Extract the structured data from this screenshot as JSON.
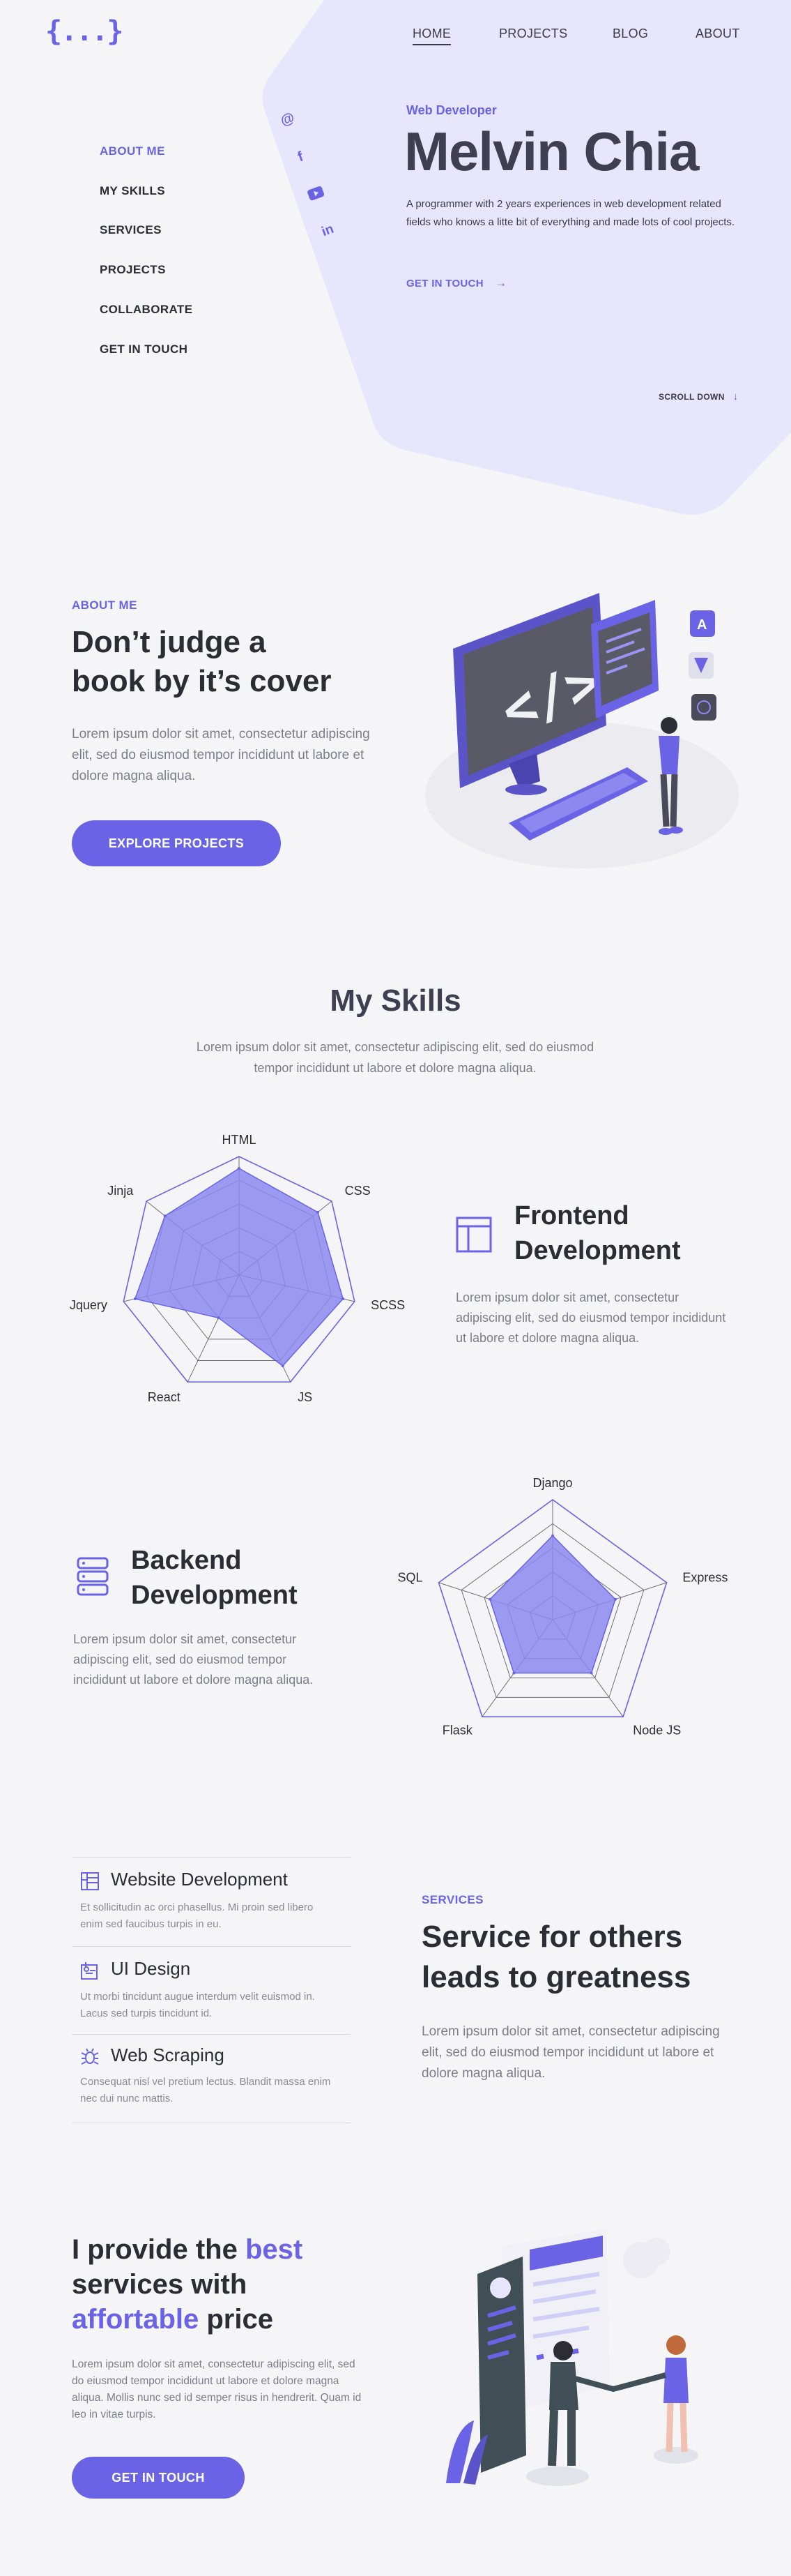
{
  "logo": "{...}",
  "nav": [
    "HOME",
    "PROJECTS",
    "BLOG",
    "ABOUT"
  ],
  "side_menu": [
    "ABOUT ME",
    "MY SKILLS",
    "SERVICES",
    "PROJECTS",
    "COLLABORATE",
    "GET IN TOUCH"
  ],
  "social_icons": [
    "at-icon",
    "facebook-icon",
    "youtube-icon",
    "linkedin-icon"
  ],
  "hero": {
    "role": "Web Developer",
    "name": "Melvin Chia",
    "bio": "A programmer with 2 years experiences in web development related fields who knows a litte bit of everything and made lots of cool projects.",
    "cta": "GET IN TOUCH",
    "scroll": "SCROLL DOWN"
  },
  "about": {
    "eyebrow": "ABOUT ME",
    "heading_line1": "Don’t judge a",
    "heading_line2": "book by it’s cover",
    "text": "Lorem ipsum dolor sit amet, consectetur adipiscing elit, sed do eiusmod tempor incididunt ut labore et dolore magna aliqua.",
    "button": "EXPLORE PROJECTS"
  },
  "skills": {
    "title": "My Skills",
    "text": "Lorem ipsum dolor sit amet, consectetur adipiscing elit, sed do eiusmod tempor incididunt ut labore et dolore magna aliqua.",
    "frontend": {
      "title_line1": "Frontend",
      "title_line2": "Development",
      "text": "Lorem ipsum dolor sit amet, consectetur adipiscing elit, sed do eiusmod tempor incididunt ut labore et dolore magna aliqua."
    },
    "backend": {
      "title_line1": "Backend",
      "title_line2": "Development",
      "text": "Lorem ipsum dolor sit amet, consectetur adipiscing elit, sed do eiusmod tempor incididunt ut labore et dolore magna aliqua."
    }
  },
  "chart_data": [
    {
      "type": "radar",
      "categories": [
        "HTML",
        "CSS",
        "SCSS",
        "JS",
        "React",
        "Jquery",
        "Jinja"
      ],
      "values": [
        90,
        85,
        90,
        85,
        40,
        90,
        80
      ],
      "range": [
        0,
        100
      ],
      "levels": 5,
      "fill": "#8c88f0",
      "stroke": "#6a63e6"
    },
    {
      "type": "radar",
      "categories": [
        "Django",
        "Express",
        "Node JS",
        "Flask",
        "SQL"
      ],
      "values": [
        70,
        55,
        55,
        55,
        55
      ],
      "range": [
        0,
        100
      ],
      "levels": 5,
      "fill": "#8c88f0",
      "stroke": "#6a63e6"
    }
  ],
  "services": {
    "items": [
      {
        "title": "Website Development",
        "desc": "Et sollicitudin ac orci phasellus. Mi proin sed libero enim sed faucibus turpis in eu.",
        "icon": "layout-icon"
      },
      {
        "title": "UI Design",
        "desc": "Ut morbi tincidunt augue interdum velit euismod in. Lacus sed turpis tincidunt id.",
        "icon": "design-icon"
      },
      {
        "title": "Web Scraping",
        "desc": "Consequat nisl vel pretium lectus. Blandit massa enim nec dui nunc mattis.",
        "icon": "bug-icon"
      }
    ],
    "eyebrow": "SERVICES",
    "heading_line1": "Service for others",
    "heading_line2": "leads to greatness",
    "text": "Lorem ipsum dolor sit amet, consectetur adipiscing elit, sed do eiusmod tempor incididunt ut labore et dolore magna aliqua."
  },
  "pricing": {
    "line1_a": "I provide the ",
    "line1_b": "best",
    "line2": "services with",
    "line3_a": "affortable",
    "line3_b": " price",
    "text": "Lorem ipsum dolor sit amet, consectetur adipiscing elit, sed do eiusmod tempor incididunt ut labore et dolore magna aliqua. Mollis nunc sed id semper risus in hendrerit. Quam id leo in vitae turpis.",
    "button": "GET IN TOUCH"
  },
  "colors": {
    "accent": "#6a63e6",
    "hero_bg": "#e7e6fd",
    "background": "#f5f5f8"
  }
}
